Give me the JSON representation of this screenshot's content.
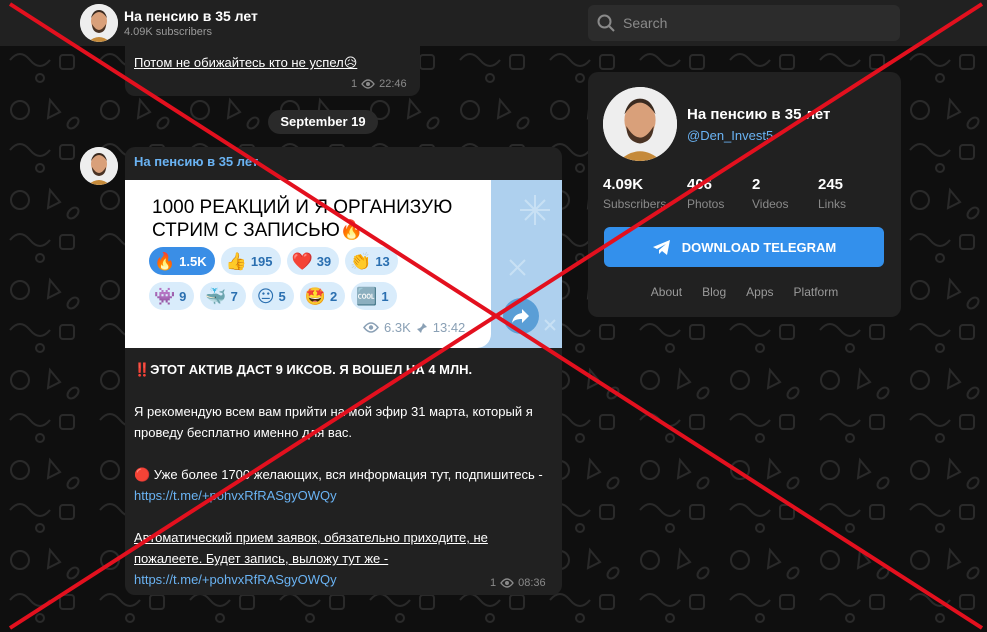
{
  "header": {
    "channel_title": "На пенсию в 35 лет",
    "subscribers": "4.09K subscribers",
    "search_placeholder": "Search"
  },
  "previous_message": {
    "text": "Потом не обижайтесь кто не успел😥",
    "views": "1",
    "time": "22:46"
  },
  "date_separator": "September 19",
  "post": {
    "author": "На пенсию в 35 лет",
    "embed": {
      "headline": "1000 РЕАКЦИЙ И Я ОРГАНИЗУЮ СТРИМ С ЗАПИСЬЮ🔥",
      "reactions_row1": [
        {
          "emoji": "🔥",
          "count": "1.5K"
        },
        {
          "emoji": "👍",
          "count": "195"
        },
        {
          "emoji": "❤️",
          "count": "39"
        },
        {
          "emoji": "👏",
          "count": "13"
        }
      ],
      "reactions_row2": [
        {
          "emoji": "👾",
          "count": "9"
        },
        {
          "emoji": "🐳",
          "count": "7"
        },
        {
          "emoji": "😐",
          "count": "5"
        },
        {
          "emoji": "🤩",
          "count": "2"
        },
        {
          "emoji": "🆒",
          "count": "1"
        }
      ],
      "views": "6.3K",
      "time": "13:42"
    },
    "line1": "‼️ЭТОТ АКТИВ ДАСТ 9 ИКСОВ. Я ВОШЕЛ НА 4 МЛН.",
    "line2": "Я рекомендую всем вам прийти на мой эфир 31 марта, который я проведу бесплатно именно для вас.",
    "line3_prefix": "🔴 Уже более 1700 желающих, вся информация тут, подпишитесь - ",
    "line3_link": "https://t.me/+pohvxRfRASgyOWQy",
    "line4": "Автоматический прием заявок, обязательно приходите, не пожалеете. Будет запись, выложу тут же - ",
    "line4_link": "https://t.me/+pohvxRfRASgyOWQy",
    "views": "1",
    "time": "08:36"
  },
  "channel_card": {
    "title": "На пенсию в 35 лет",
    "handle": "@Den_Invest5",
    "stats": [
      {
        "value": "4.09K",
        "label": "Subscribers"
      },
      {
        "value": "406",
        "label": "Photos"
      },
      {
        "value": "2",
        "label": "Videos"
      },
      {
        "value": "245",
        "label": "Links"
      }
    ],
    "download_label": "DOWNLOAD TELEGRAM",
    "footer_links": [
      "About",
      "Blog",
      "Apps",
      "Platform"
    ]
  },
  "colors": {
    "accent": "#3390ec",
    "link": "#6ab3f3",
    "cross": "#e3101e"
  },
  "icons": [
    "search-icon",
    "eye-icon",
    "share-icon",
    "telegram-plane-icon"
  ]
}
